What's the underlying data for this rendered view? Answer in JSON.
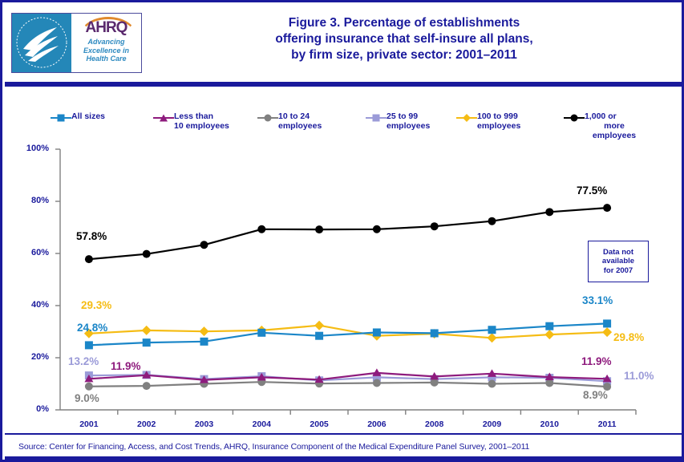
{
  "header": {
    "title_lines": [
      "Figure 3. Percentage of establishments",
      "offering insurance that self-insure all plans,",
      "by firm size, private sector: 2001–2011"
    ],
    "logo": {
      "agency_acronym": "AHRQ",
      "tagline_lines": [
        "Advancing",
        "Excellence in",
        "Health Care"
      ],
      "seal_text": "DEPARTMENT OF HEALTH & HUMAN SERVICES USA"
    }
  },
  "legend": {
    "items": [
      {
        "label_line1": "All sizes",
        "label_line2": "",
        "color": "#1b86c8",
        "marker": "square"
      },
      {
        "label_line1": "Less than",
        "label_line2": "10 employees",
        "color": "#8e1b7d",
        "marker": "triangle"
      },
      {
        "label_line1": "10 to 24",
        "label_line2": "employees",
        "color": "#808080",
        "marker": "circle"
      },
      {
        "label_line1": "25 to 99",
        "label_line2": "employees",
        "color": "#9b9bd8",
        "marker": "square"
      },
      {
        "label_line1": "100 to 999",
        "label_line2": "employees",
        "color": "#f5bc14",
        "marker": "diamond"
      },
      {
        "label_line1": "1,000 or",
        "label_line2": "more employees",
        "color": "#000000",
        "marker": "circle"
      }
    ]
  },
  "annotation": {
    "note_lines": [
      "Data not",
      "available",
      "for 2007"
    ]
  },
  "footer": {
    "source": "Source: Center for Financing, Access, and Cost Trends, AHRQ,  Insurance Component of the Medical Expenditure Panel Survey,  2001–2011"
  },
  "chart_data": {
    "type": "line",
    "title": "Figure 3. Percentage of establishments offering insurance that self-insure all plans, by firm size, private sector: 2001–2011",
    "xlabel": "",
    "ylabel": "",
    "ylim": [
      0,
      100
    ],
    "yticks": [
      0,
      20,
      40,
      60,
      80,
      100
    ],
    "ytick_labels": [
      "0%",
      "20%",
      "40%",
      "60%",
      "80%",
      "100%"
    ],
    "grid": false,
    "legend_position": "top",
    "categories": [
      "2001",
      "2002",
      "2003",
      "2004",
      "2005",
      "2006",
      "2008",
      "2009",
      "2010",
      "2011"
    ],
    "series": [
      {
        "name": "All sizes",
        "color": "#1b86c8",
        "marker": "square",
        "values": [
          24.8,
          25.8,
          26.2,
          29.6,
          28.4,
          29.7,
          29.4,
          30.7,
          32.1,
          33.1
        ],
        "start_label": "24.8%",
        "end_label": "33.1%"
      },
      {
        "name": "Less than 10 employees",
        "color": "#8e1b7d",
        "marker": "triangle",
        "values": [
          11.9,
          13.3,
          11.5,
          12.5,
          11.6,
          14.2,
          12.8,
          13.9,
          12.6,
          11.9
        ],
        "start_label": "11.9%",
        "end_label": "11.9%"
      },
      {
        "name": "10 to 24 employees",
        "color": "#808080",
        "marker": "circle",
        "values": [
          9.0,
          9.2,
          10.0,
          10.7,
          10.1,
          10.3,
          10.5,
          10.0,
          10.3,
          8.9
        ],
        "start_label": "9.0%",
        "end_label": "8.9%"
      },
      {
        "name": "25 to 99 employees",
        "color": "#9b9bd8",
        "marker": "square",
        "values": [
          13.2,
          13.4,
          11.8,
          12.9,
          11.3,
          12.5,
          11.8,
          12.5,
          12.3,
          11.0
        ],
        "start_label": "13.2%",
        "end_label": "11.0%"
      },
      {
        "name": "100 to 999 employees",
        "color": "#f5bc14",
        "marker": "diamond",
        "values": [
          29.3,
          30.5,
          30.1,
          30.5,
          32.4,
          28.4,
          29.2,
          27.6,
          28.9,
          29.8
        ],
        "start_label": "29.3%",
        "end_label": "29.8%"
      },
      {
        "name": "1,000 or more employees",
        "color": "#000000",
        "marker": "circle",
        "values": [
          57.8,
          59.8,
          63.3,
          69.3,
          69.2,
          69.3,
          70.4,
          72.4,
          75.9,
          77.5
        ],
        "start_label": "57.8%",
        "end_label": "77.5%"
      }
    ],
    "missing_year": "2007"
  }
}
